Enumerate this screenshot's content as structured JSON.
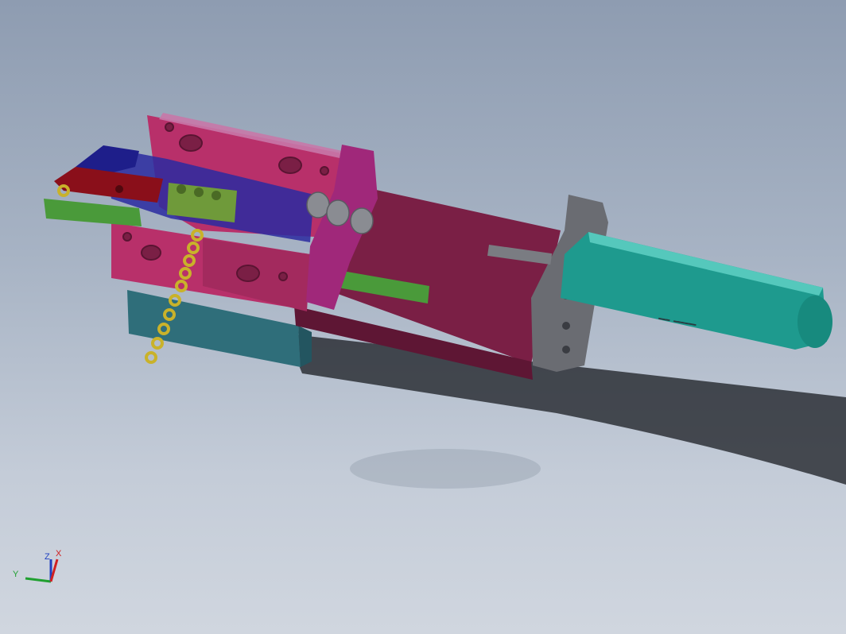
{
  "viewport": {
    "background_top": "#8e9cb1",
    "background_bottom": "#d0d6df"
  },
  "model": {
    "colors": {
      "top_plate": "#a0285a",
      "top_plate_dark": "#7a1f45",
      "upper_block": "#b8306a",
      "base_block": "#2f6e7a",
      "blue_slide": "#2a2aa0",
      "red_finger": "#8a0f1a",
      "green_bar": "#4a9a3a",
      "yellow_block": "#6f9a3a",
      "chain": "#c9b22a",
      "cylinder": "#1e9a8e",
      "flange": "#6a6c72",
      "bracket": "#a0287a",
      "shadow": "#1a1c22"
    }
  },
  "triad": {
    "x_label": "X",
    "y_label": "Y",
    "z_label": "Z",
    "x_color": "#d02020",
    "y_color": "#20a030",
    "z_color": "#2040c0"
  }
}
